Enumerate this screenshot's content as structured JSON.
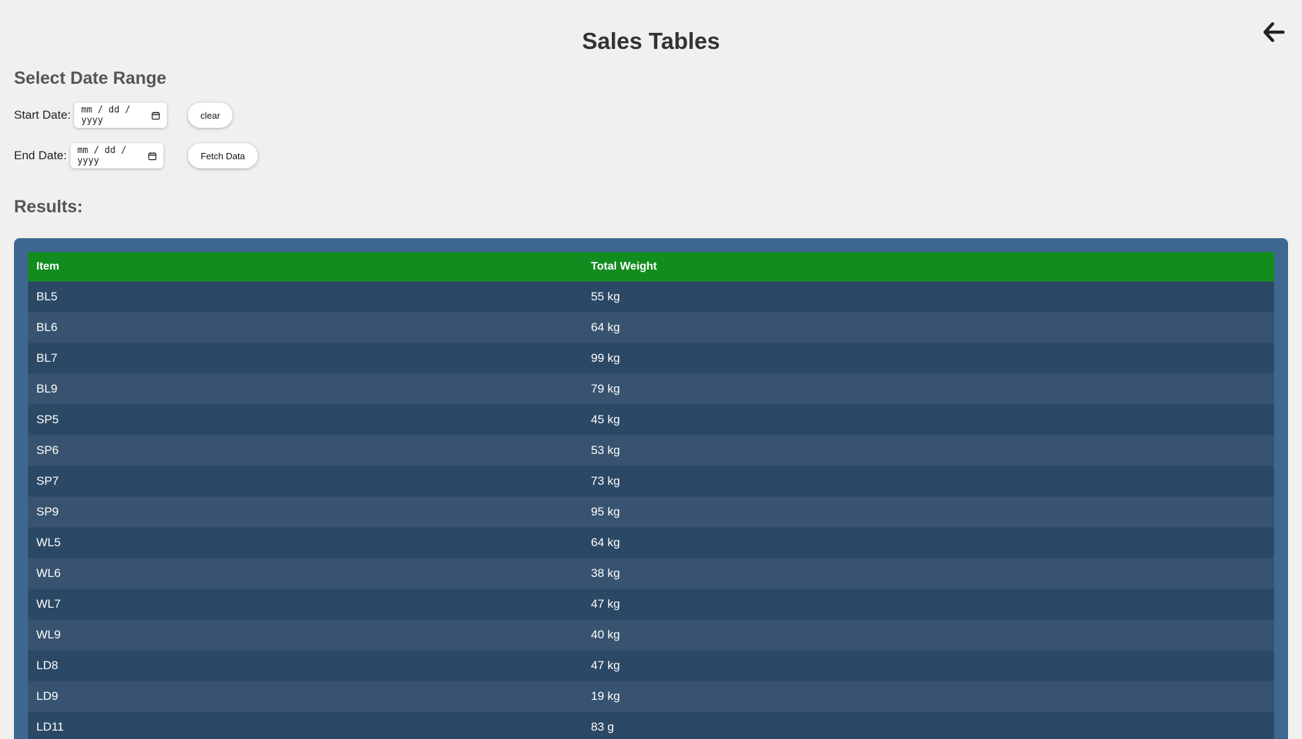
{
  "header": {
    "title": "Sales Tables",
    "back_icon": "arrow-left-icon"
  },
  "date_range": {
    "heading": "Select Date Range",
    "start_label": "Start Date:",
    "start_value": "mm / dd / yyyy",
    "end_label": "End Date:",
    "end_value": "mm / dd / yyyy",
    "calendar_icon": "calendar-icon",
    "clear_label": "clear",
    "fetch_label": "Fetch Data"
  },
  "results": {
    "heading": "Results:",
    "columns": [
      "Item",
      "Total Weight"
    ],
    "rows": [
      [
        "BL5",
        "55 kg"
      ],
      [
        "BL6",
        "64 kg"
      ],
      [
        "BL7",
        "99 kg"
      ],
      [
        "BL9",
        "79 kg"
      ],
      [
        "SP5",
        "45 kg"
      ],
      [
        "SP6",
        "53 kg"
      ],
      [
        "SP7",
        "73 kg"
      ],
      [
        "SP9",
        "95 kg"
      ],
      [
        "WL5",
        "64 kg"
      ],
      [
        "WL6",
        "38 kg"
      ],
      [
        "WL7",
        "47 kg"
      ],
      [
        "WL9",
        "40 kg"
      ],
      [
        "LD8",
        "47 kg"
      ],
      [
        "LD9",
        "19 kg"
      ],
      [
        "LD11",
        "83 g"
      ]
    ]
  },
  "colors": {
    "background": "#f0f0f0",
    "panel": "#3e6890",
    "table_header": "#128c1f",
    "row_dark": "#2b4865",
    "row_light": "#37536f"
  }
}
